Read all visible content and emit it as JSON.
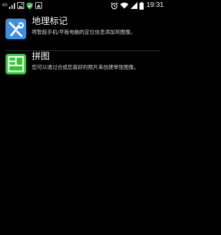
{
  "status_bar": {
    "network_label": "4G",
    "time": "19:31"
  },
  "options": [
    {
      "icon": "geotag-icon",
      "title": "地理标记",
      "description": "将智能手机/平板电脑的定位信息添加到图像。",
      "icon_color": "#3b8fe8"
    },
    {
      "icon": "collage-icon",
      "title": "拼图",
      "description": "您可以通过合成您喜好的照片来创建单张图像。",
      "icon_color": "#34c534"
    }
  ],
  "colors": {
    "background": "#000000",
    "title_text": "#ffffff",
    "description_text": "#d2d2d2"
  }
}
